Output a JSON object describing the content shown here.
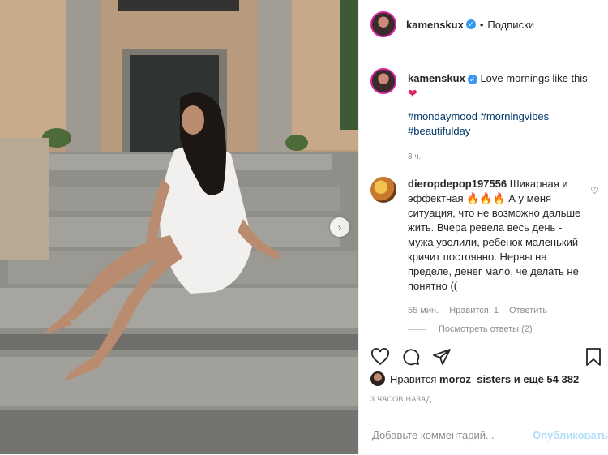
{
  "post": {
    "username": "kamenskux",
    "follow_label": "Подписки",
    "caption_text": "Love mornings like this",
    "caption_emoji": "❤",
    "hashtags_line1": "#mondaymood #morningvibes",
    "hashtags_line2": "#beautifulday",
    "caption_time": "3 ч."
  },
  "comment": {
    "username": "dieropdepop197556",
    "text": "Шикарная и эффектная 🔥🔥🔥 А у меня ситуация, что не возможно дальше жить. Вчера ревела весь день - мужа уволили, ребенок маленький кричит постоянно. Нервы на пределе, денег мало, че делать не понятно ((",
    "time": "55 мин.",
    "likes": "Нравится: 1",
    "reply_label": "Ответить",
    "view_replies": "Посмотреть ответы (2)"
  },
  "likes": {
    "prefix": "Нравится",
    "user": "moroz_sisters",
    "suffix": "и ещё 54 382"
  },
  "posted_ago": "3 ЧАСОВ НАЗАД",
  "add_comment": {
    "placeholder": "Добавьте комментарий...",
    "publish_label": "Опубликовать"
  },
  "icons": {
    "verified": "verified-badge-icon",
    "next": "chevron-right-icon",
    "like": "heart-icon",
    "comment": "comment-icon",
    "share": "paper-plane-icon",
    "save": "bookmark-icon"
  },
  "colors": {
    "link": "#00376b",
    "publish_disabled": "#b2dffc",
    "verified": "#3897f0"
  }
}
